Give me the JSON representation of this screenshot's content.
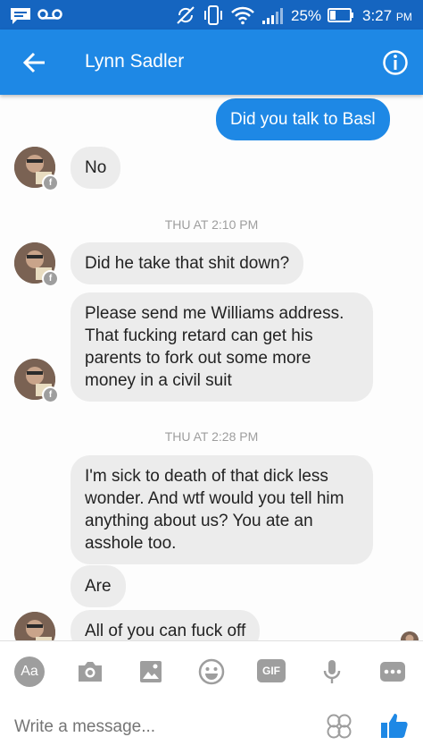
{
  "status_bar": {
    "battery_percent": "25%",
    "time": "3:27",
    "ampm": "PM"
  },
  "header": {
    "contact_name": "Lynn Sadler"
  },
  "messages": [
    {
      "sender": "me",
      "text": "Did you talk to Basl"
    },
    {
      "sender": "them",
      "text": "No"
    },
    {
      "type": "timestamp",
      "text": "THU AT 2:10 PM"
    },
    {
      "sender": "them",
      "text": "Did he take that shit down?"
    },
    {
      "sender": "them",
      "lines": [
        "Please send me Williams address.",
        "That fucking retard can get his",
        "parents to fork out some more",
        "money in a civil suit"
      ]
    },
    {
      "type": "timestamp",
      "text": "THU AT 2:28 PM"
    },
    {
      "sender": "them",
      "lines": [
        "I'm sick to death of that dick less",
        "wonder. And wtf would you tell him",
        "anything about us? You ate an",
        "asshole too."
      ]
    },
    {
      "sender": "them",
      "text": "Are"
    },
    {
      "sender": "them",
      "text": "All of you can fuck off"
    }
  ],
  "composer": {
    "toolbar": [
      {
        "icon": "text-format-icon",
        "label": "Aa"
      },
      {
        "icon": "camera-icon"
      },
      {
        "icon": "image-icon"
      },
      {
        "icon": "emoji-icon"
      },
      {
        "icon": "gif-icon",
        "label": "GIF"
      },
      {
        "icon": "microphone-icon"
      },
      {
        "icon": "more-icon"
      }
    ],
    "placeholder": "Write a message...",
    "send_icon": "thumbs-up-icon"
  },
  "colors": {
    "status_bar": "#1565c0",
    "app_bar": "#1e88e5",
    "outgoing_bubble": "#1e88e5",
    "incoming_bubble": "#ececec",
    "toolbar_icon": "#9e9e9e"
  }
}
